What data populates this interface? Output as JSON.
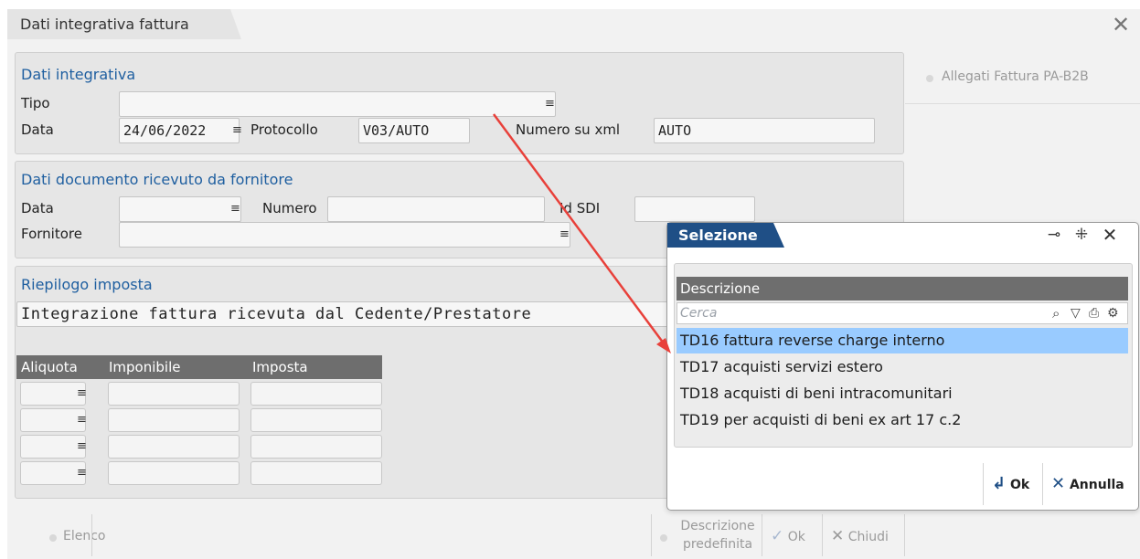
{
  "window": {
    "title": "Dati integrativa fattura",
    "close_icon": "close-icon"
  },
  "integrativa": {
    "title": "Dati integrativa",
    "tipo_label": "Tipo",
    "tipo_value": "",
    "data_label": "Data",
    "data_value": "24/06/2022",
    "protocollo_label": "Protocollo",
    "protocollo_value": "V03/AUTO",
    "numero_xml_label": "Numero su xml",
    "numero_xml_value": "AUTO"
  },
  "documento": {
    "title": "Dati documento ricevuto da fornitore",
    "data_label": "Data",
    "data_value": "",
    "numero_label": "Numero",
    "numero_value": "",
    "idsdi_label": "Id SDI",
    "idsdi_value": "",
    "fornitore_label": "Fornitore",
    "fornitore_value": ""
  },
  "riepilogo": {
    "title": "Riepilogo imposta",
    "description": "Integrazione fattura ricevuta dal Cedente/Prestatore",
    "columns": [
      "Aliquota",
      "Imponibile",
      "Imposta"
    ]
  },
  "right_panel": {
    "allegati_label": "Allegati Fattura PA-B2B"
  },
  "bottom": {
    "elenco_label": "Elenco",
    "descrizione_line1": "Descrizione",
    "descrizione_line2": "predefinita",
    "ok_label": "Ok",
    "chiudi_label": "Chiudi"
  },
  "popup": {
    "title": "Selezione",
    "column_header": "Descrizione",
    "search_placeholder": "Cerca",
    "items": [
      "TD16 fattura reverse charge interno",
      "TD17 acquisti servizi estero",
      "TD18 acquisti di beni intracomunitari",
      "TD19 per acquisti di beni ex art 17 c.2"
    ],
    "selected_index": 0,
    "ok_label": "Ok",
    "annulla_label": "Annulla"
  },
  "colors": {
    "accent": "#1f4f86",
    "group_title": "#1f5fa0",
    "selection": "#99cbff",
    "annotation_arrow": "#e8403a"
  }
}
